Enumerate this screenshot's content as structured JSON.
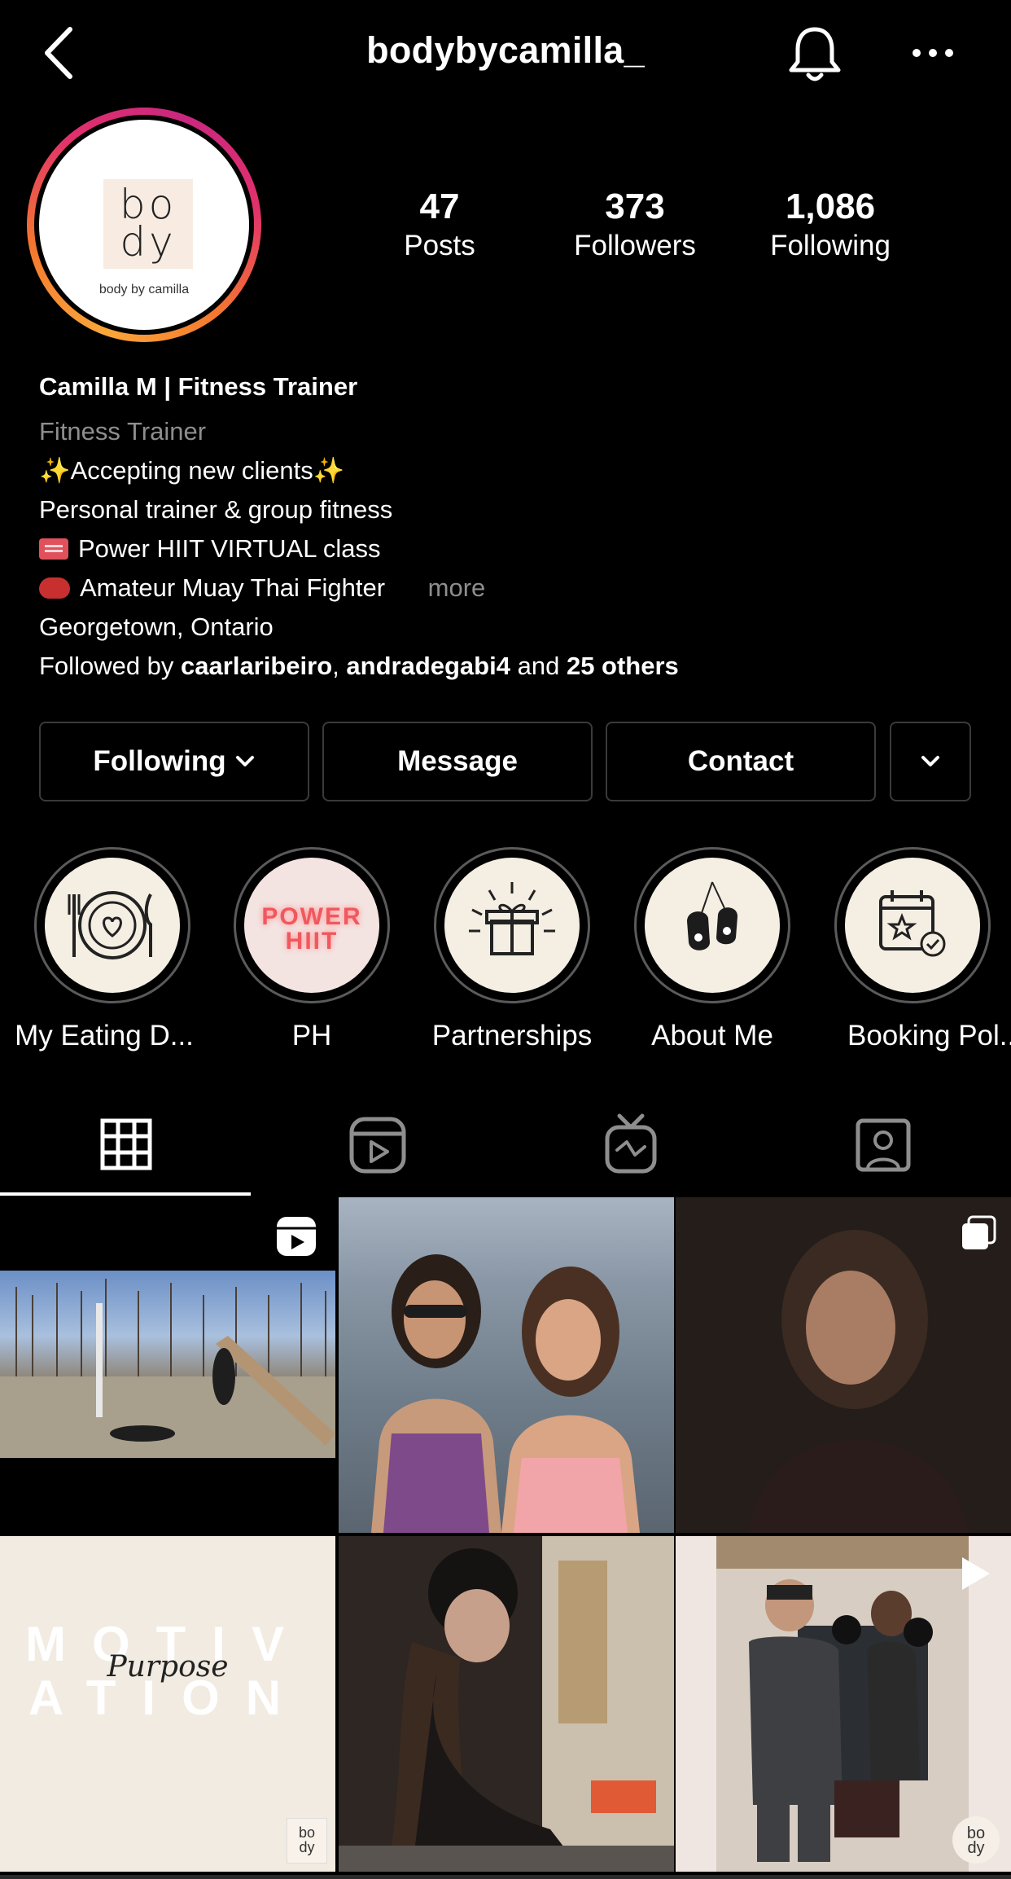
{
  "header": {
    "username": "bodybycamilla_",
    "back_icon": "chevron-left-icon",
    "bell_icon": "bell-icon",
    "more_icon": "more-horizontal-icon"
  },
  "profile": {
    "avatar_logo_text": "bo dy",
    "avatar_caption": "body by camilla",
    "stats": [
      {
        "value": "47",
        "label": "Posts"
      },
      {
        "value": "373",
        "label": "Followers"
      },
      {
        "value": "1,086",
        "label": "Following"
      }
    ],
    "name": "Camilla M | Fitness Trainer",
    "category": "Fitness Trainer",
    "bio": {
      "line1": "Accepting new clients",
      "line2": "Personal trainer & group fitness",
      "line3": "Power HIIT VIRTUAL class",
      "line4": "Amateur Muay Thai Fighter",
      "more": "more",
      "location": "Georgetown, Ontario"
    },
    "followed_by": {
      "prefix": "Followed by",
      "user1": "caarlaribeiro",
      "user2": "andradegabi4",
      "and": "and",
      "others": "25 others"
    }
  },
  "actions": {
    "following": "Following",
    "message": "Message",
    "contact": "Contact"
  },
  "highlights": [
    {
      "label": "My Eating D..."
    },
    {
      "label": "PH",
      "art_text_1": "POWER",
      "art_text_2": "HIIT"
    },
    {
      "label": "Partnerships"
    },
    {
      "label": "About Me"
    },
    {
      "label": "Booking Pol..."
    }
  ],
  "tabs": [
    "grid-icon",
    "reels-icon",
    "igtv-icon",
    "tagged-icon"
  ],
  "grid": {
    "posts": [
      {
        "type": "reel"
      },
      {
        "type": "photo"
      },
      {
        "type": "carousel"
      },
      {
        "type": "photo",
        "text_1": "MOTIV",
        "text_2": "ATION",
        "script": "Purpose"
      },
      {
        "type": "photo"
      },
      {
        "type": "video"
      }
    ]
  },
  "colors": {
    "background": "#000000",
    "button_border": "#3a3a3a",
    "muted_text": "#8e8e8e",
    "highlight_bg": "#f4eee3"
  }
}
